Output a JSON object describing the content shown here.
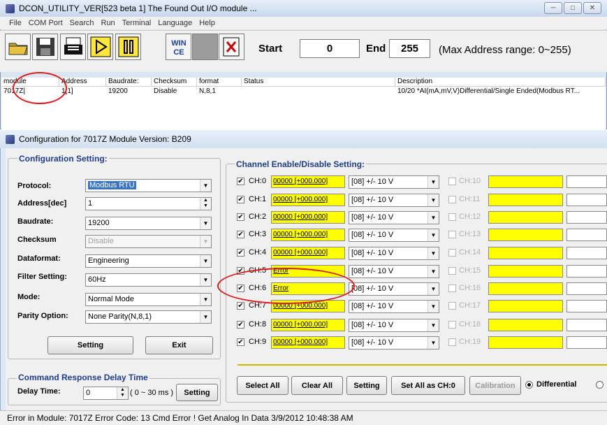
{
  "main_window": {
    "title": "DCON_UTILITY_VER[523 beta 1] The Found Out I/O module ...",
    "menu": [
      "File",
      "COM Port",
      "Search",
      "Run",
      "Terminal",
      "Language",
      "Help"
    ],
    "toolbar_icons": [
      "open-folder-icon",
      "save-disk-icon",
      "print-icon",
      "play-icon",
      "pause-icon",
      "wince-icon",
      "blank-icon",
      "exit-icon"
    ],
    "wince_text": "WIN\nCE",
    "start_label": "Start",
    "start_value": "0",
    "end_label": "End",
    "end_value": "255",
    "range_note": "(Max Address range: 0~255)"
  },
  "module_list": {
    "columns": [
      "module",
      "Address",
      "Baudrate:",
      "Checksum",
      "format",
      "Status",
      "Description"
    ],
    "rows": [
      {
        "module": "7017Z|",
        "address": "1[1]",
        "baudrate": "19200",
        "checksum": "Disable",
        "format": "N,8,1",
        "status": "",
        "description": "10/20 *AI(mA,mV,V)Differential/Single Ended(Modbus RT..."
      }
    ]
  },
  "config_window": {
    "title": "Configuration for 7017Z Module Version: B209",
    "config_group_title": "Configuration Setting:",
    "fields": [
      {
        "label": "Protocol:",
        "value": "Modbus RTU"
      },
      {
        "label": "Address[dec]",
        "value": "1"
      },
      {
        "label": "Baudrate:",
        "value": "19200"
      },
      {
        "label": "Checksum",
        "value": "Disable"
      },
      {
        "label": "Dataformat:",
        "value": "Engineering"
      },
      {
        "label": "Filter Setting:",
        "value": "60Hz"
      },
      {
        "label": "Mode:",
        "value": "Normal Mode"
      },
      {
        "label": "Parity Option:",
        "value": "None Parity(N,8,1)"
      }
    ],
    "setting_button": "Setting",
    "exit_button": "Exit",
    "delay_group_title": "Command Response Delay Time",
    "delay_label": "Delay Time:",
    "delay_value": "0",
    "delay_range": "( 0 ~ 30 ms )",
    "delay_setting_button": "Setting",
    "channel_group_title": "Channel Enable/Disable Setting:",
    "channels_left": [
      {
        "label": "CH:0",
        "value": "00000 [+000.000]",
        "range": "[08] +/- 10 V",
        "checked": true
      },
      {
        "label": "CH:1",
        "value": "00000 [+000.000]",
        "range": "[08] +/- 10 V",
        "checked": true
      },
      {
        "label": "CH:2",
        "value": "00000 [+000.000]",
        "range": "[08] +/- 10 V",
        "checked": true
      },
      {
        "label": "CH:3",
        "value": "00000 [+000.000]",
        "range": "[08] +/- 10 V",
        "checked": true
      },
      {
        "label": "CH:4",
        "value": "00000 [+000.000]",
        "range": "[08] +/- 10 V",
        "checked": true
      },
      {
        "label": "CH:5",
        "value": "Error",
        "range": "[08] +/- 10 V",
        "checked": true
      },
      {
        "label": "CH:6",
        "value": "Error",
        "range": "[08] +/- 10 V",
        "checked": true
      },
      {
        "label": "CH:7",
        "value": "00000 [+000.000]",
        "range": "[08] +/- 10 V",
        "checked": true
      },
      {
        "label": "CH:8",
        "value": "00000 [+000.000]",
        "range": "[08] +/- 10 V",
        "checked": true
      },
      {
        "label": "CH:9",
        "value": "00000 [+000.000]",
        "range": "[08] +/- 10 V",
        "checked": true
      }
    ],
    "channels_right": [
      "CH:10",
      "CH:11",
      "CH:12",
      "CH:13",
      "CH:14",
      "CH:15",
      "CH:16",
      "CH:17",
      "CH:18",
      "CH:19"
    ],
    "buttons": {
      "select_all": "Select All",
      "clear_all": "Clear All",
      "setting": "Setting",
      "set_all": "Set All as CH:0",
      "calibration": "Calibration"
    },
    "mode_radio": "Differential"
  },
  "status_bar": "Error in Module: 7017Z  Error Code:  13    Cmd Error !   Get Analog In Data 3/9/2012 10:48:38 AM",
  "colors": {
    "highlight_yellow": "#ffff00",
    "annotation_red": "#e2191b",
    "group_title_blue": "#1f3d8a"
  }
}
